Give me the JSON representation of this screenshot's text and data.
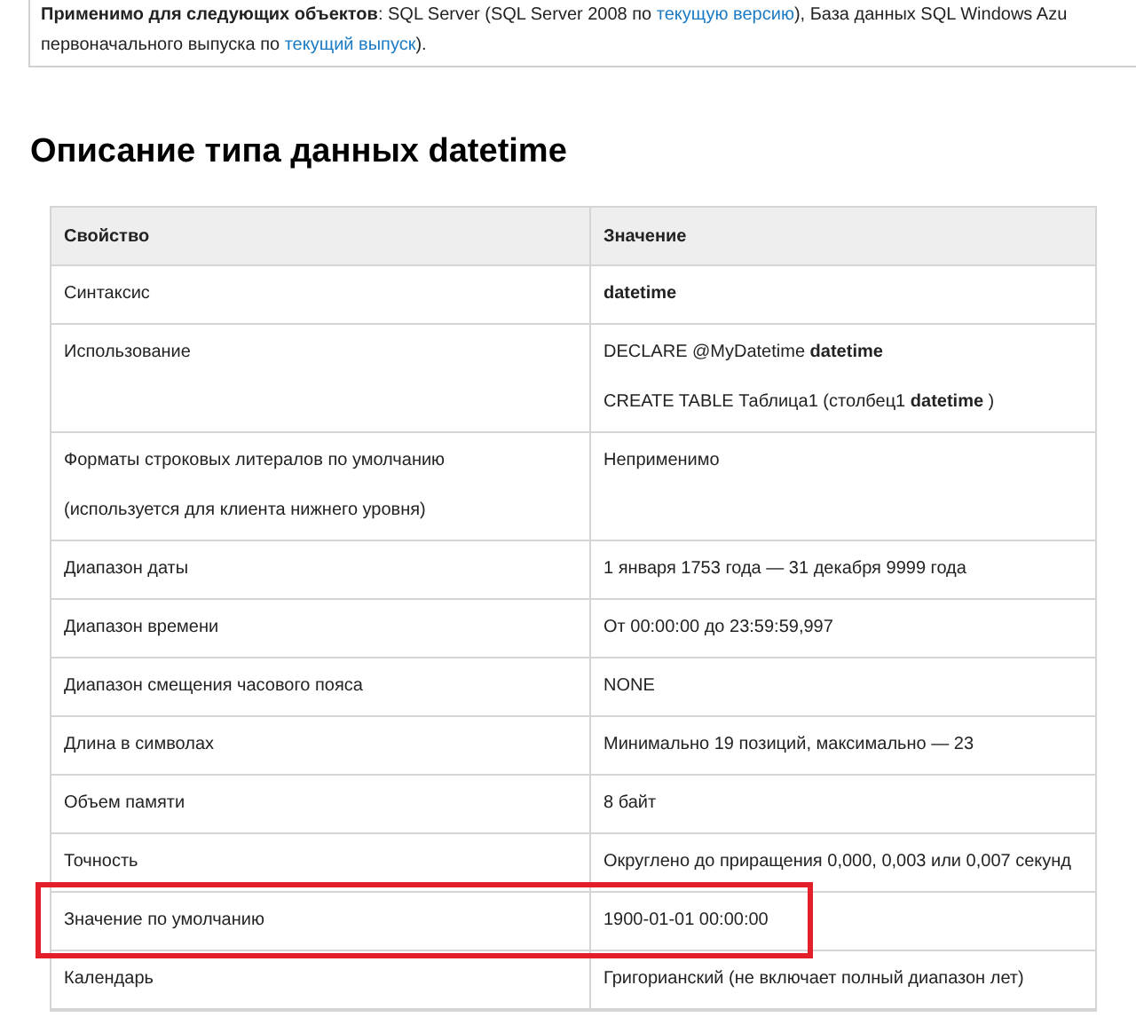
{
  "applies_note": {
    "lines": [
      [
        {
          "kind": "text",
          "text": "**Применимо для следующих объектов**: SQL Server (SQL Server 2008 по "
        },
        {
          "kind": "link",
          "text": "текущую версию"
        },
        {
          "kind": "text",
          "text": "), База данных SQL Windows Azu"
        }
      ],
      [
        {
          "kind": "text",
          "text": "первоначального выпуска по "
        },
        {
          "kind": "link",
          "text": "текущий выпуск"
        },
        {
          "kind": "text",
          "text": ")."
        }
      ]
    ]
  },
  "heading": "Описание типа данных datetime",
  "table": {
    "columns": [
      "Свойство",
      "Значение"
    ],
    "rows": [
      {
        "property": [
          "Синтаксис"
        ],
        "value": [
          "**datetime**"
        ],
        "highlighted": false
      },
      {
        "property": [
          "Использование"
        ],
        "value": [
          "DECLARE @MyDatetime **datetime**",
          "CREATE TABLE Таблица1 (столбец1 **datetime** )"
        ],
        "highlighted": false
      },
      {
        "property": [
          "Форматы строковых литералов по умолчанию",
          "(используется для клиента нижнего уровня)"
        ],
        "value": [
          "Неприменимо"
        ],
        "highlighted": false
      },
      {
        "property": [
          "Диапазон даты"
        ],
        "value": [
          "1 января 1753 года — 31 декабря 9999 года"
        ],
        "highlighted": false
      },
      {
        "property": [
          "Диапазон времени"
        ],
        "value": [
          "От 00:00:00 до 23:59:59,997"
        ],
        "highlighted": false
      },
      {
        "property": [
          "Диапазон смещения часового пояса"
        ],
        "value": [
          "NONE"
        ],
        "highlighted": false
      },
      {
        "property": [
          "Длина в символах"
        ],
        "value": [
          "Минимально 19 позиций, максимально — 23"
        ],
        "highlighted": false
      },
      {
        "property": [
          "Объем памяти"
        ],
        "value": [
          "8 байт"
        ],
        "highlighted": false
      },
      {
        "property": [
          "Точность"
        ],
        "value": [
          "Округлено до приращения 0,000, 0,003 или 0,007 секунд"
        ],
        "highlighted": false
      },
      {
        "property": [
          "Значение по умолчанию"
        ],
        "value": [
          "1900-01-01 00:00:00"
        ],
        "highlighted": true
      },
      {
        "property": [
          "Календарь"
        ],
        "value": [
          "Григорианский (не включает полный диапазон лет)"
        ],
        "highlighted": false
      }
    ]
  }
}
